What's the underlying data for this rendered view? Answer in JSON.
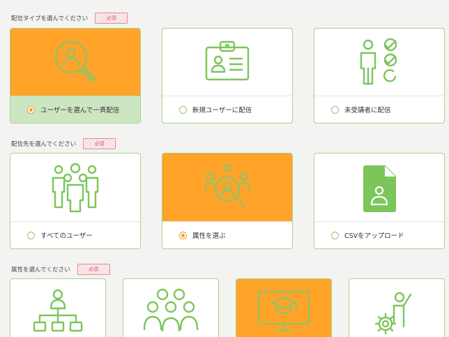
{
  "sections": [
    {
      "title": "配信タイプを選んでください",
      "badge": "必須",
      "options": [
        {
          "label": "ユーザーを選んで一斉配信",
          "icon": "user-search-icon",
          "selected": true
        },
        {
          "label": "新規ユーザーに配信",
          "icon": "id-badge-icon",
          "selected": false
        },
        {
          "label": "未受講者に配信",
          "icon": "person-checklist-icon",
          "selected": false
        }
      ]
    },
    {
      "title": "配信先を選んでください",
      "badge": "必須",
      "options": [
        {
          "label": "すべてのユーザー",
          "icon": "group-people-icon",
          "selected": false
        },
        {
          "label": "属性を選ぶ",
          "icon": "group-search-icon",
          "selected": true
        },
        {
          "label": "CSVをアップロード",
          "icon": "csv-file-user-icon",
          "selected": false
        }
      ]
    },
    {
      "title": "属性を選んでください",
      "badge": "必須",
      "options": [
        {
          "label": "",
          "icon": "org-chart-icon",
          "selected": false
        },
        {
          "label": "",
          "icon": "team-people-icon",
          "selected": false
        },
        {
          "label": "",
          "icon": "online-graduate-icon",
          "selected": true
        },
        {
          "label": "",
          "icon": "person-gear-icon",
          "selected": false
        }
      ]
    }
  ],
  "colors": {
    "selected_bg": "#ffa428",
    "icon_green": "#7cc55a",
    "border_green": "#a5d38e",
    "badge_pink": "#d05a6e"
  }
}
